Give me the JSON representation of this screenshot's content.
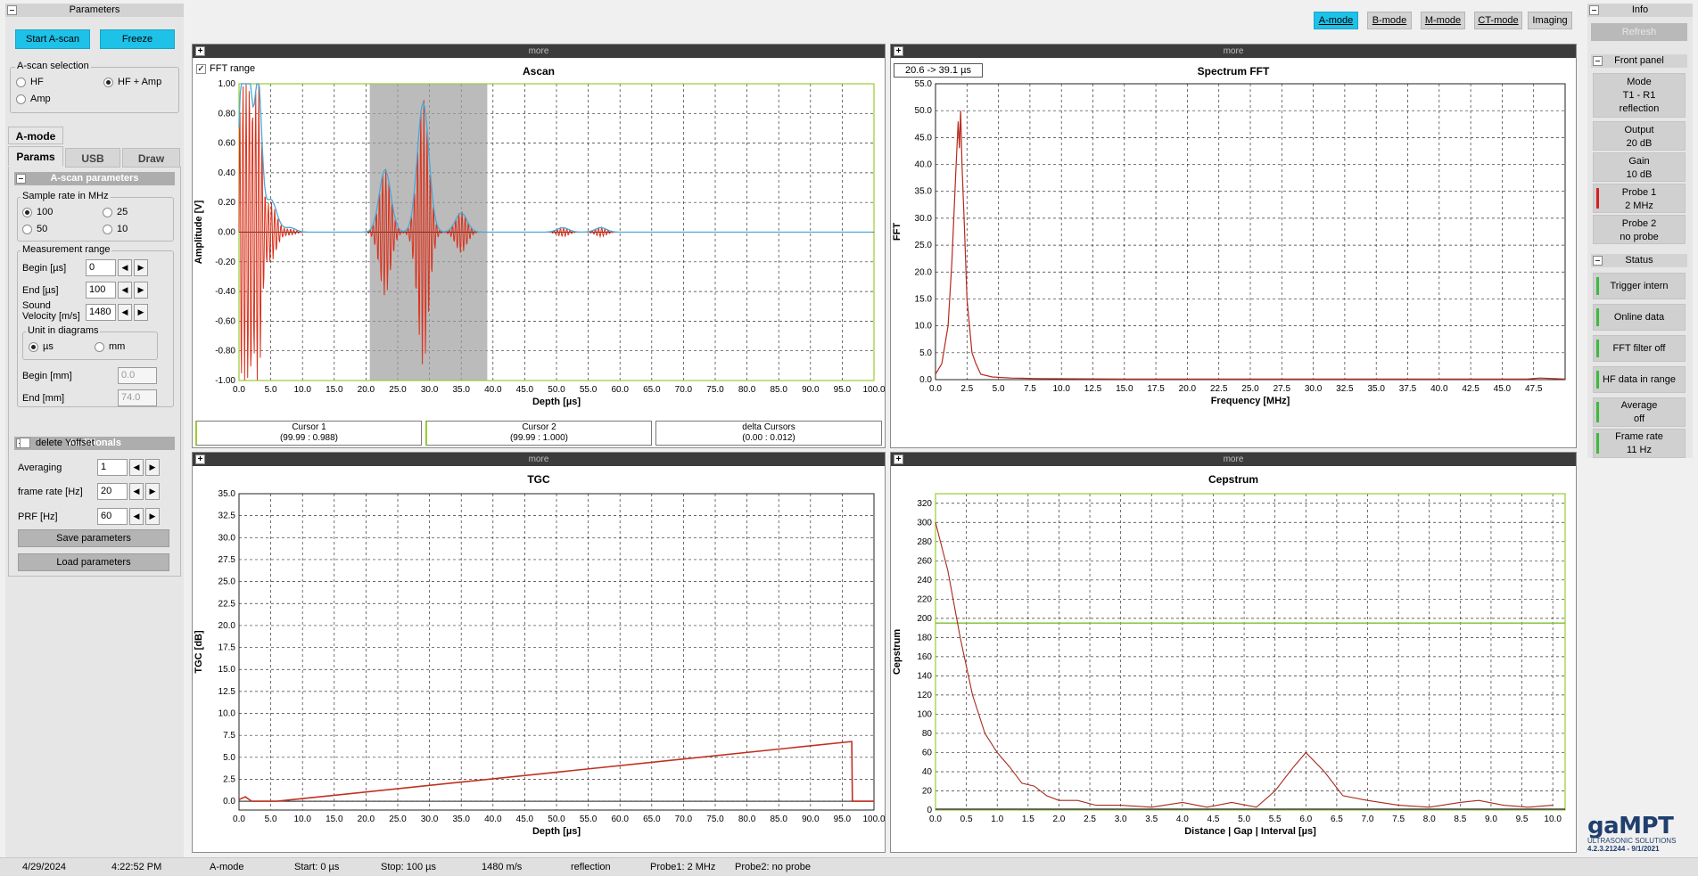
{
  "left": {
    "parameters_title": "Parameters",
    "start_ascan": "Start A-scan",
    "freeze": "Freeze",
    "ascan_selection": {
      "legend": "A-scan selection",
      "hf": "HF",
      "hf_amp": "HF + Amp",
      "amp": "Amp",
      "selected": "HF + Amp"
    },
    "mode_tab": "A-mode",
    "tabs": [
      "Params",
      "USB",
      "Draw"
    ],
    "ascan_params_title": "A-scan parameters",
    "sample_rate": {
      "legend": "Sample rate  in MHz",
      "options": [
        "100",
        "25",
        "50",
        "10"
      ],
      "selected": "100"
    },
    "measurement_range": {
      "legend": "Measurement range",
      "begin_label": "Begin [µs]",
      "begin_value": "0",
      "end_label": "End [µs]",
      "end_value": "100",
      "sound_velocity_label": "Sound Velocity [m/s]",
      "sound_velocity_value": "1480",
      "unit_legend": "Unit in diagrams",
      "unit_us": "µs",
      "unit_mm": "mm",
      "unit_selected": "µs",
      "begin_mm_label": "Begin [mm]",
      "begin_mm_value": "0.0",
      "end_mm_label": "End [mm]",
      "end_mm_value": "74.0"
    },
    "additionals_title": "Additionals",
    "delete_yoffset": "delete Yoffset",
    "averaging_label": "Averaging",
    "averaging_value": "1",
    "frame_rate_label": "frame rate [Hz]",
    "frame_rate_value": "20",
    "prf_label": "PRF [Hz]",
    "prf_value": "60",
    "save_parameters": "Save parameters",
    "load_parameters": "Load parameters"
  },
  "modes": [
    "A-mode",
    "B-mode",
    "M-mode",
    "CT-mode",
    "Imaging"
  ],
  "active_mode": "A-mode",
  "panels": {
    "more": "more",
    "ascan": {
      "title": "Ascan",
      "fft_range_label": "FFT range",
      "range_badge": "20.6 -> 39.1 µs",
      "cursor1_title": "Cursor 1",
      "cursor1_value": "(99.99 : 0.988)",
      "cursor2_title": "Cursor 2",
      "cursor2_value": "(99.99 : 1.000)",
      "delta_title": "delta Cursors",
      "delta_value": "(0.00 : 0.012)"
    }
  },
  "info": {
    "title": "Info",
    "refresh": "Refresh",
    "front_panel": "Front panel",
    "mode": [
      "Mode",
      "T1 - R1",
      "reflection"
    ],
    "output": [
      "Output",
      "20 dB"
    ],
    "gain": [
      "Gain",
      "10 dB"
    ],
    "probe1": [
      "Probe 1",
      "2 MHz"
    ],
    "probe2": [
      "Probe 2",
      "no probe"
    ],
    "status_title": "Status",
    "status": [
      [
        "Trigger intern"
      ],
      [
        "Online data"
      ],
      [
        "FFT filter off"
      ],
      [
        "HF data in range"
      ],
      [
        "Average",
        "off"
      ],
      [
        "Frame rate",
        "11 Hz"
      ]
    ],
    "colors": {
      "green": "#3dba3d",
      "red": "#d62020"
    }
  },
  "logo": {
    "name": "gaMPT",
    "tagline": "ULTRASONIC SOLUTIONS",
    "version": "4.2.3.21244 - 9/1/2021"
  },
  "statusbar": {
    "date": "4/29/2024",
    "time": "4:22:52 PM",
    "mode": "A-mode",
    "start": "Start: 0 µs",
    "stop": "Stop: 100 µs",
    "velocity": "1480 m/s",
    "measurement": "reflection",
    "probe1": "Probe1: 2 MHz",
    "probe2": "Probe2: no probe"
  },
  "chart_data": [
    {
      "type": "line",
      "title": "Ascan",
      "xlabel": "Depth [µs]",
      "ylabel": "Amplitude [V]",
      "xlim": [
        0,
        100
      ],
      "ylim": [
        -1.0,
        1.0
      ],
      "grid": true,
      "x_ticks": [
        "0.0",
        "5.0",
        "10.0",
        "15.0",
        "20.0",
        "25.0",
        "30.0",
        "35.0",
        "40.0",
        "45.0",
        "50.0",
        "55.0",
        "60.0",
        "65.0",
        "70.0",
        "75.0",
        "80.0",
        "85.0",
        "90.0",
        "95.0",
        "100.0"
      ],
      "y_ticks": [
        "1.00",
        "0.80",
        "0.60",
        "0.40",
        "0.20",
        "0.00",
        "-0.20",
        "-0.40",
        "-0.60",
        "-0.80",
        "-1.00"
      ],
      "shaded_range": [
        20.6,
        39.1
      ],
      "series": [
        {
          "color": "#d9321c",
          "kind": "hf",
          "x": [
            0.5,
            1.5,
            3.0,
            5.0,
            8.0,
            23.0,
            29.0,
            35.0,
            51.0,
            57.0
          ],
          "peak": [
            1.0,
            1.0,
            1.0,
            0.2,
            0.02,
            0.43,
            0.9,
            0.14,
            0.03,
            0.03
          ]
        },
        {
          "color": "#4aa8d8",
          "kind": "envelope",
          "x": [
            0.5,
            1.5,
            3.0,
            5.0,
            8.0,
            23.0,
            29.0,
            35.0,
            51.0,
            57.0
          ],
          "peak": [
            1.0,
            1.0,
            1.0,
            0.22,
            0.03,
            0.42,
            0.87,
            0.13,
            0.03,
            0.03
          ]
        }
      ]
    },
    {
      "type": "line",
      "title": "Spectrum FFT",
      "xlabel": "Frequency [MHz]",
      "ylabel": "FFT",
      "xlim": [
        0,
        50
      ],
      "ylim": [
        0,
        55
      ],
      "grid": true,
      "x_ticks": [
        "0.0",
        "2.5",
        "5.0",
        "7.5",
        "10.0",
        "12.5",
        "15.0",
        "17.5",
        "20.0",
        "22.5",
        "25.0",
        "27.5",
        "30.0",
        "32.5",
        "35.0",
        "37.5",
        "40.0",
        "42.5",
        "45.0",
        "47.5"
      ],
      "y_ticks": [
        "55.0",
        "50.0",
        "45.0",
        "40.0",
        "35.0",
        "30.0",
        "25.0",
        "20.0",
        "15.0",
        "10.0",
        "5.0",
        "0.0"
      ],
      "series": [
        {
          "color": "#b8281a",
          "x": [
            0,
            0.5,
            1.0,
            1.3,
            1.6,
            1.8,
            1.9,
            2.0,
            2.1,
            2.3,
            2.5,
            2.7,
            2.9,
            3.2,
            3.6,
            4.5,
            6,
            8,
            15,
            47,
            48,
            50
          ],
          "y": [
            1,
            3,
            10,
            22,
            38,
            48,
            43,
            50,
            40,
            28,
            15,
            10,
            5,
            3,
            1,
            0.5,
            0.3,
            0.2,
            0.1,
            0.1,
            0.3,
            0.1
          ]
        }
      ]
    },
    {
      "type": "line",
      "title": "TGC",
      "xlabel": "Depth [µs]",
      "ylabel": "TGC [dB]",
      "xlim": [
        0,
        100
      ],
      "ylim": [
        -1,
        35
      ],
      "grid": true,
      "x_ticks": [
        "0.0",
        "5.0",
        "10.0",
        "15.0",
        "20.0",
        "25.0",
        "30.0",
        "35.0",
        "40.0",
        "45.0",
        "50.0",
        "55.0",
        "60.0",
        "65.0",
        "70.0",
        "75.0",
        "80.0",
        "85.0",
        "90.0",
        "95.0",
        "100.0"
      ],
      "y_ticks": [
        "35.0",
        "32.5",
        "30.0",
        "27.5",
        "25.0",
        "22.5",
        "20.0",
        "17.5",
        "15.0",
        "12.5",
        "10.0",
        "7.5",
        "5.0",
        "2.5",
        "0.0"
      ],
      "series": [
        {
          "color": "#c0301f",
          "x": [
            0,
            1,
            2,
            6,
            96.5,
            96.6,
            100
          ],
          "y": [
            0.2,
            0.5,
            0.0,
            0.0,
            6.8,
            0.0,
            0.0
          ]
        }
      ]
    },
    {
      "type": "line",
      "title": "Cepstrum",
      "xlabel": "Distance | Gap | Interval [µs]",
      "ylabel": "Cepstrum",
      "xlim": [
        0,
        10.2
      ],
      "ylim": [
        0,
        330
      ],
      "grid": true,
      "threshold": 195,
      "x_ticks": [
        "0.0",
        "0.5",
        "1.0",
        "1.5",
        "2.0",
        "2.5",
        "3.0",
        "3.5",
        "4.0",
        "4.5",
        "5.0",
        "5.5",
        "6.0",
        "6.5",
        "7.0",
        "7.5",
        "8.0",
        "8.5",
        "9.0",
        "9.5",
        "10.0"
      ],
      "y_ticks": [
        "320",
        "300",
        "280",
        "260",
        "240",
        "220",
        "200",
        "180",
        "160",
        "140",
        "120",
        "100",
        "80",
        "60",
        "40",
        "20",
        "0"
      ],
      "series": [
        {
          "color": "#a62a1c",
          "x": [
            0,
            0.2,
            0.4,
            0.6,
            0.8,
            1.0,
            1.2,
            1.4,
            1.6,
            1.8,
            2.0,
            2.3,
            2.6,
            3.0,
            3.5,
            4.0,
            4.4,
            4.8,
            5.2,
            5.5,
            5.8,
            6.0,
            6.3,
            6.6,
            7.0,
            7.5,
            8.0,
            8.5,
            8.8,
            9.2,
            9.6,
            10.0
          ],
          "y": [
            300,
            250,
            180,
            120,
            80,
            60,
            45,
            28,
            25,
            15,
            10,
            10,
            5,
            5,
            3,
            8,
            3,
            8,
            3,
            20,
            45,
            60,
            40,
            15,
            10,
            5,
            3,
            8,
            10,
            5,
            3,
            5
          ]
        }
      ]
    }
  ]
}
